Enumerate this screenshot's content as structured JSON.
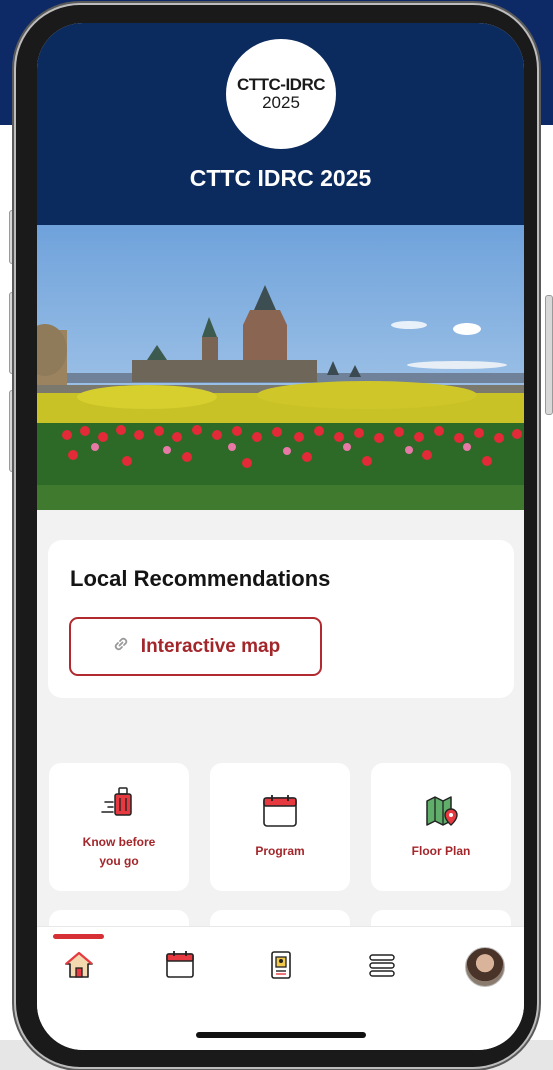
{
  "header": {
    "logo_line1": "CTTC-IDRC",
    "logo_line2": "2025",
    "title": "CTTC IDRC 2025"
  },
  "recommendations": {
    "title": "Local Recommendations",
    "button_label": "Interactive map"
  },
  "tiles": [
    {
      "label": "Know before\nyou go",
      "icon": "luggage-icon"
    },
    {
      "label": "Program",
      "icon": "calendar-icon"
    },
    {
      "label": "Floor Plan",
      "icon": "map-pin-icon"
    }
  ],
  "tabbar": {
    "tabs": [
      "home-icon",
      "calendar-icon",
      "badge-icon",
      "menu-icon",
      "avatar"
    ],
    "active_index": 0
  },
  "colors": {
    "header_bg": "#0b2a5e",
    "accent": "#a3262b",
    "tile_icon_green": "#4a9a5a"
  }
}
